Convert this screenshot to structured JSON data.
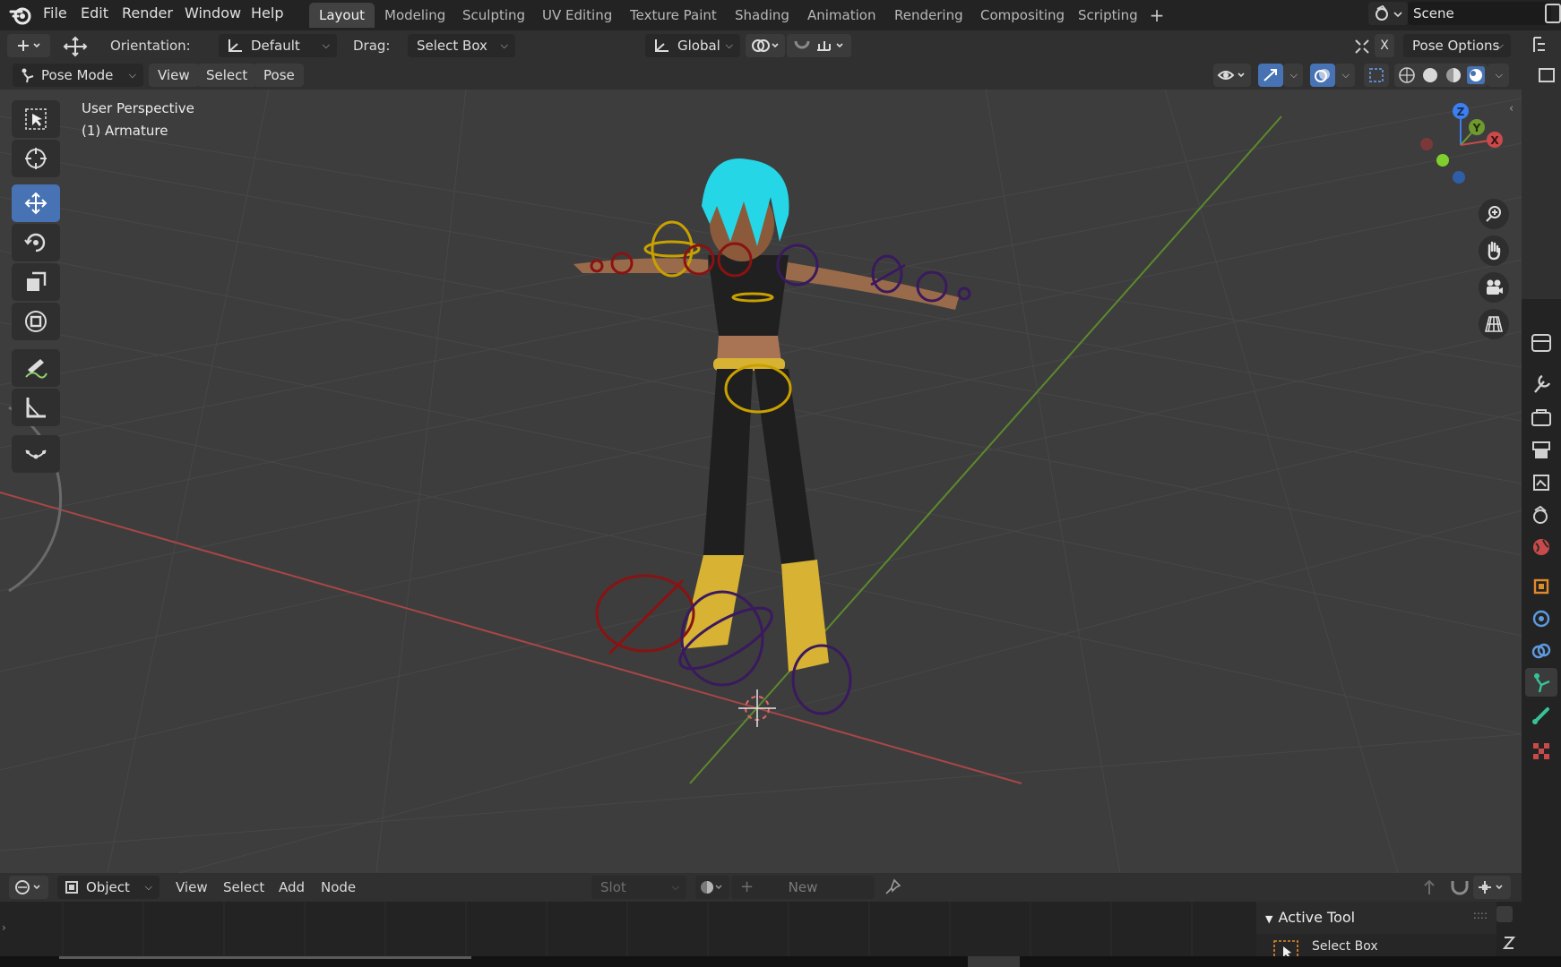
{
  "topbar": {
    "menus": [
      "File",
      "Edit",
      "Render",
      "Window",
      "Help"
    ],
    "workspaces": [
      "Layout",
      "Modeling",
      "Sculpting",
      "UV Editing",
      "Texture Paint",
      "Shading",
      "Animation",
      "Rendering",
      "Compositing",
      "Scripting"
    ],
    "active_workspace": "Layout",
    "scene": "Scene"
  },
  "tool_header": {
    "orientation_label": "Orientation:",
    "orientation_value": "Default",
    "drag_label": "Drag:",
    "drag_value": "Select Box",
    "transform_orientation": "Global",
    "pose_options": "Pose Options"
  },
  "viewport_header": {
    "mode": "Pose Mode",
    "menus": [
      "View",
      "Select",
      "Pose"
    ]
  },
  "viewport": {
    "view_name": "User Perspective",
    "object_name": "(1) Armature",
    "gizmo_axes": [
      "Z",
      "Y",
      "X"
    ]
  },
  "bottom_editor": {
    "object_type": "Object",
    "menus": [
      "View",
      "Select",
      "Add",
      "Node"
    ],
    "slot": "Slot",
    "new_label": "New",
    "active_tool_title": "Active Tool",
    "active_tool_value": "Select Box"
  },
  "colors": {
    "accent": "#4772b3",
    "viewport_bg": "#3d3d3d",
    "x_axis": "#c94a4a",
    "y_axis": "#6e9a2e",
    "z_axis": "#3c7ff0"
  }
}
